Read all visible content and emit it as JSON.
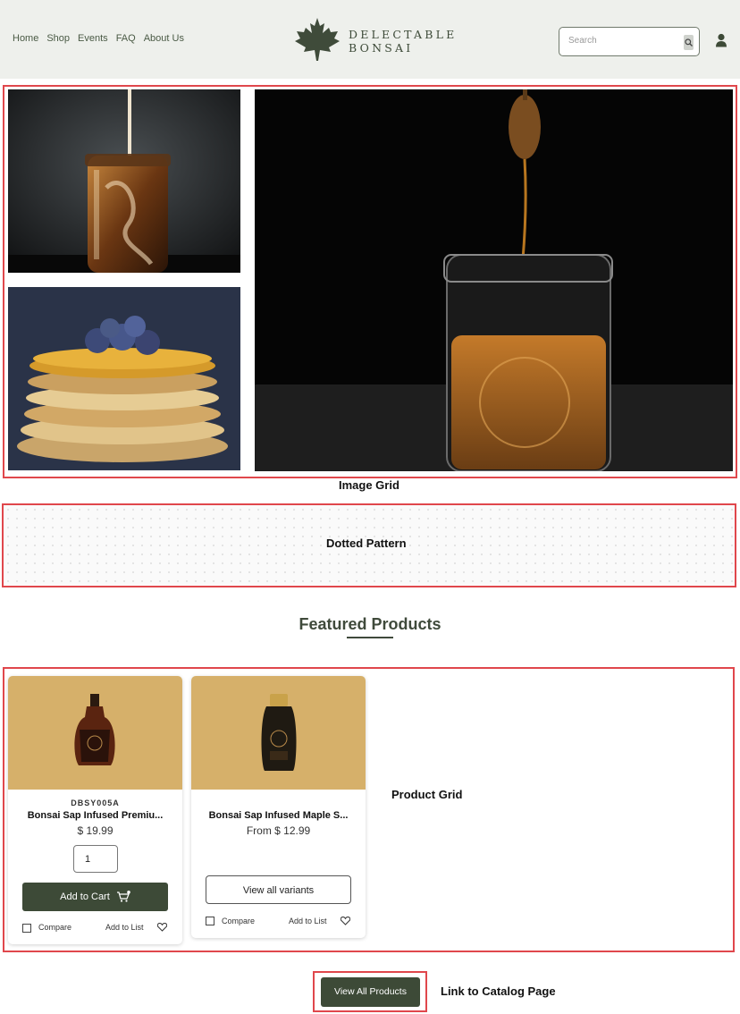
{
  "header": {
    "nav": [
      "Home",
      "Shop",
      "Events",
      "FAQ",
      "About Us"
    ],
    "brand_line1": "DELECTABLE",
    "brand_line2": "BONSAI",
    "search_placeholder": "Search"
  },
  "annotations": {
    "image_grid": "Image Grid",
    "dotted_pattern": "Dotted Pattern",
    "product_grid": "Product Grid",
    "catalog_link": "Link to Catalog Page"
  },
  "featured": {
    "title": "Featured Products"
  },
  "products": [
    {
      "sku": "DBSY005A",
      "name": "Bonsai Sap Infused Premiu...",
      "price": "$ 19.99",
      "qty": "1",
      "cta": "Add to Cart",
      "compare": "Compare",
      "add_to_list": "Add to List"
    },
    {
      "name": "Bonsai Sap Infused Maple S...",
      "price": "From $ 12.99",
      "cta": "View all variants",
      "compare": "Compare",
      "add_to_list": "Add to List"
    }
  ],
  "view_all_label": "View All Products",
  "colors": {
    "header_bg": "#eef0ec",
    "brand_green": "#3d4a37",
    "product_bg": "#d6b06a",
    "annotation_red": "#e0474c"
  }
}
